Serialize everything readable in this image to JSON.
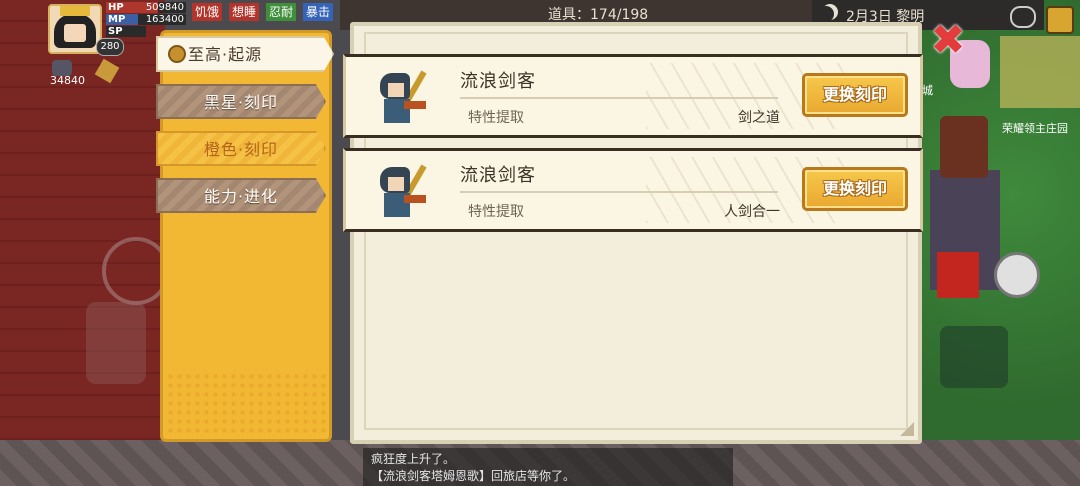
{
  "hud": {
    "hp_label": "HP",
    "hp_value": "509840",
    "hp_fraction": 0.65,
    "mp_label": "MP",
    "mp_value": "163400",
    "mp_fraction": 0.4,
    "sp_label": "SP",
    "level": "280",
    "gold": "34840",
    "status_tags": [
      "饥饿",
      "想睡",
      "忍耐",
      "暴击"
    ],
    "status_colors": [
      "#b3342b",
      "#b3342b",
      "#3f8f3a",
      "#3563b7"
    ],
    "props": "道具：174/198",
    "date": "2月3日  黎明"
  },
  "background": {
    "map_label": "荣耀领主庄园",
    "town_label": "城",
    "log_lines": [
      "疯狂度上升了。",
      "【流浪剑客塔姆恩歌】回旅店等你了。"
    ]
  },
  "tabs": [
    {
      "label": "至高·起源",
      "state": "active"
    },
    {
      "label": "黑星·刻印",
      "state": "normal"
    },
    {
      "label": "橙色·刻印",
      "state": "highlight"
    },
    {
      "label": "能力·进化",
      "state": "normal"
    }
  ],
  "rows": [
    {
      "name": "流浪剑客",
      "subtitle": "特性提取",
      "trait": "剑之道",
      "button": "更换刻印"
    },
    {
      "name": "流浪剑客",
      "subtitle": "特性提取",
      "trait": "人剑合一",
      "button": "更换刻印"
    }
  ],
  "close_symbol": "✖",
  "colors": {
    "accent_gold": "#f3b833",
    "button_gold": "#e9a82f",
    "panel_bg": "#f3eedc",
    "close_red": "#e33c3c"
  }
}
